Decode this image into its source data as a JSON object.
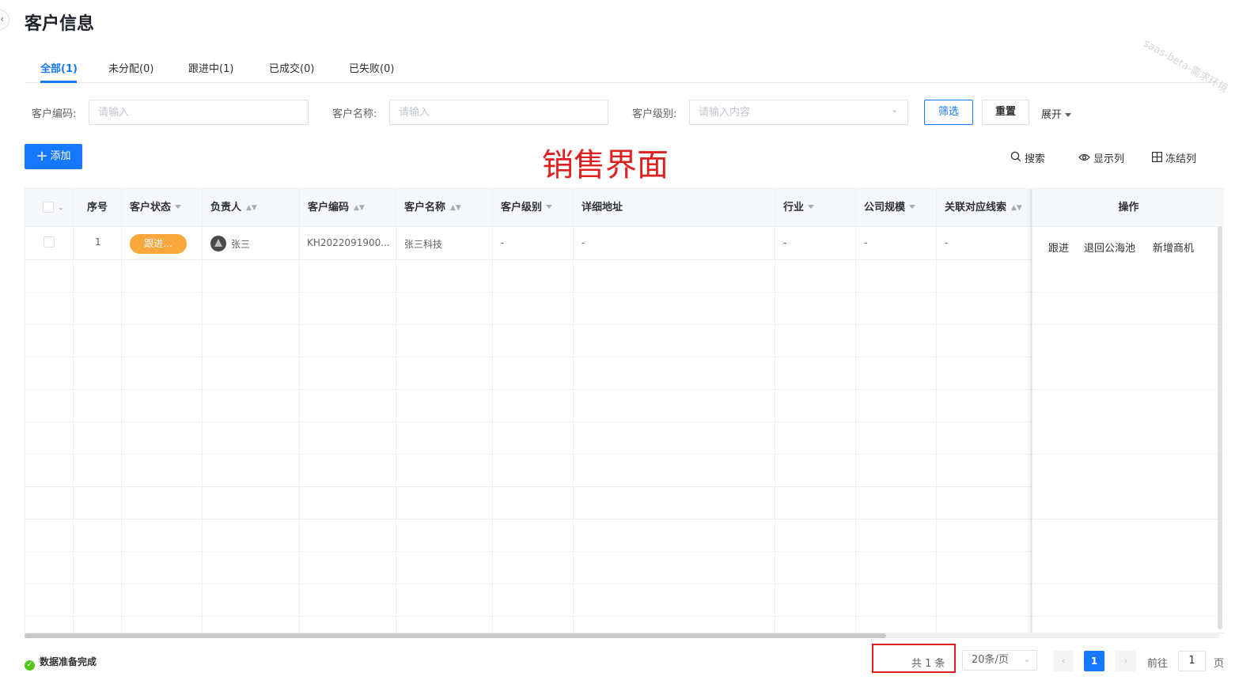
{
  "header": {
    "title": "客户信息",
    "back_icon": "‹",
    "watermark": "saas-beta-需求环境"
  },
  "tabs": [
    {
      "label": "全部(1)",
      "active": true
    },
    {
      "label": "未分配(0)",
      "active": false
    },
    {
      "label": "跟进中(1)",
      "active": false
    },
    {
      "label": "已成交(0)",
      "active": false
    },
    {
      "label": "已失败(0)",
      "active": false
    }
  ],
  "filters": {
    "code_label": "客户编码:",
    "code_placeholder": "请输入",
    "name_label": "客户名称:",
    "name_placeholder": "请输入",
    "level_label": "客户级别:",
    "level_placeholder": "请输入内容",
    "filter_button": "筛选",
    "reset_button": "重置",
    "expand_label": "展开"
  },
  "toolbar": {
    "add_label": "添加",
    "annotation": "销售界面",
    "search_label": "搜索",
    "columns_label": "显示列",
    "freeze_label": "冻结列"
  },
  "table": {
    "columns": [
      "序号",
      "客户状态",
      "负责人",
      "客户编码",
      "客户名称",
      "客户级别",
      "详细地址",
      "行业",
      "公司规模",
      "关联对应线索",
      "操作"
    ],
    "rows": [
      {
        "index": "1",
        "status": "跟进...",
        "owner": "张三",
        "code": "KH2022091900...",
        "name": "张三科技",
        "level": "-",
        "address": "-",
        "industry": "-",
        "scale": "-",
        "clue": "-",
        "actions": [
          "跟进",
          "退回公海池",
          "新增商机"
        ]
      }
    ]
  },
  "footer": {
    "status": "数据准备完成",
    "total": "共 1 条",
    "page_size": "20条/页",
    "current_page": "1",
    "goto_prefix": "前往",
    "goto_value": "1",
    "goto_suffix": "页"
  },
  "colors": {
    "primary": "#1677ff",
    "status_pill": "#f7a73c",
    "annotation": "#e02020",
    "success": "#52c41a"
  }
}
